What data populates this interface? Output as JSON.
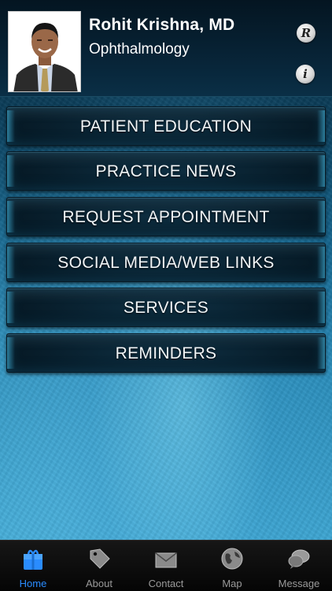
{
  "header": {
    "name": "Rohit Krishna, MD",
    "specialty": "Ophthalmology",
    "r_button": "R",
    "info_button": "i"
  },
  "menu": {
    "items": [
      {
        "label": "PATIENT EDUCATION"
      },
      {
        "label": "PRACTICE NEWS"
      },
      {
        "label": "REQUEST APPOINTMENT"
      },
      {
        "label": "SOCIAL MEDIA/WEB LINKS"
      },
      {
        "label": "SERVICES"
      },
      {
        "label": "REMINDERS"
      }
    ]
  },
  "tabbar": {
    "active": "Home",
    "active_color": "#2a8cff",
    "tabs": [
      {
        "label": "Home",
        "icon": "home-icon"
      },
      {
        "label": "About",
        "icon": "tag-icon"
      },
      {
        "label": "Contact",
        "icon": "envelope-icon"
      },
      {
        "label": "Map",
        "icon": "globe-icon"
      },
      {
        "label": "Message",
        "icon": "chat-bubble-icon"
      }
    ]
  }
}
